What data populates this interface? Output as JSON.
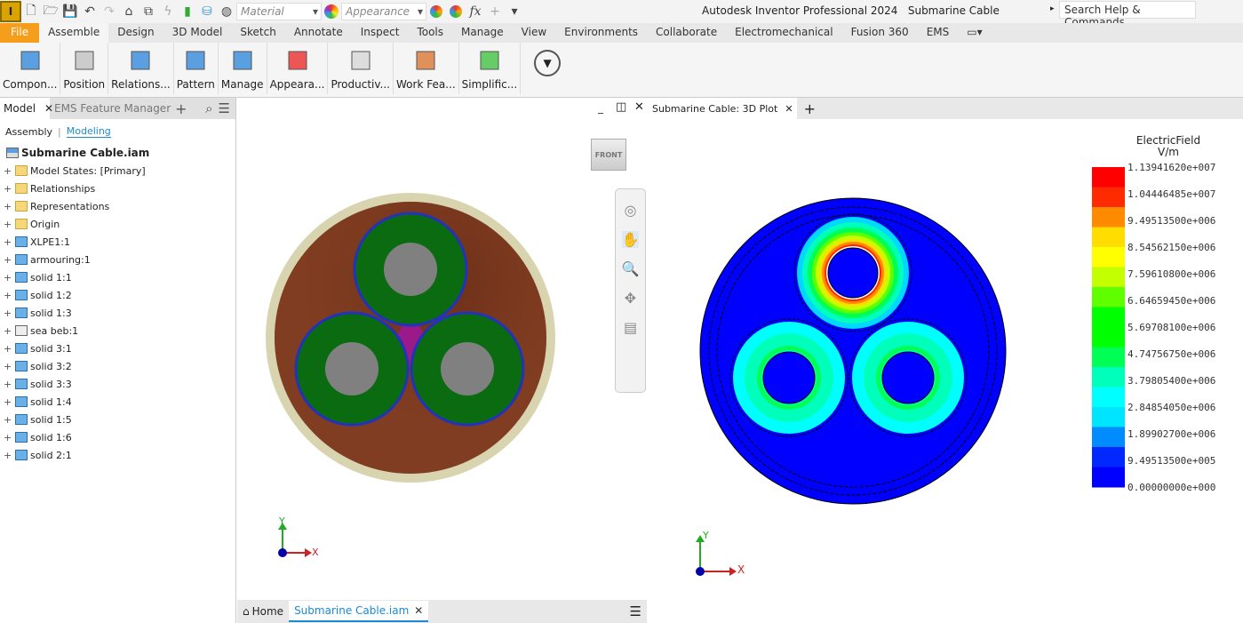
{
  "app": {
    "title": "Autodesk Inventor Professional 2024",
    "document": "Submarine Cable",
    "search_placeholder": "Search Help & Commands...",
    "logo": "I"
  },
  "qat": {
    "material": "Material",
    "appearance": "Appearance"
  },
  "menu_tabs": [
    "File",
    "Assemble",
    "Design",
    "3D Model",
    "Sketch",
    "Annotate",
    "Inspect",
    "Tools",
    "Manage",
    "View",
    "Environments",
    "Collaborate",
    "Electromechanical",
    "Fusion 360",
    "EMS"
  ],
  "active_tab": "Assemble",
  "ribbon": [
    {
      "label": "Compon...",
      "icon": "component-icon"
    },
    {
      "label": "Position",
      "icon": "position-icon"
    },
    {
      "label": "Relations...",
      "icon": "relationships-icon"
    },
    {
      "label": "Pattern",
      "icon": "pattern-icon"
    },
    {
      "label": "Manage",
      "icon": "manage-icon"
    },
    {
      "label": "Appeara...",
      "icon": "appearance-icon"
    },
    {
      "label": "Productiv...",
      "icon": "productivity-icon"
    },
    {
      "label": "Work Fea...",
      "icon": "work-features-icon"
    },
    {
      "label": "Simplific...",
      "icon": "simplification-icon"
    }
  ],
  "browser": {
    "tab_model": "Model",
    "tab_ems": "EMS Feature Manager",
    "mode_assembly": "Assembly",
    "mode_modeling": "Modeling",
    "root": "Submarine Cable.iam",
    "items": [
      {
        "label": "Model States: [Primary]",
        "icon": "folder"
      },
      {
        "label": "Relationships",
        "icon": "folder"
      },
      {
        "label": "Representations",
        "icon": "folder"
      },
      {
        "label": "Origin",
        "icon": "folder"
      },
      {
        "label": "XLPE1:1",
        "icon": "part"
      },
      {
        "label": "armouring:1",
        "icon": "part"
      },
      {
        "label": "solid 1:1",
        "icon": "part"
      },
      {
        "label": "solid 1:2",
        "icon": "part"
      },
      {
        "label": "solid 1:3",
        "icon": "part"
      },
      {
        "label": "sea beb:1",
        "icon": "part-frame"
      },
      {
        "label": "solid 3:1",
        "icon": "part"
      },
      {
        "label": "solid 3:2",
        "icon": "part"
      },
      {
        "label": "solid 3:3",
        "icon": "part"
      },
      {
        "label": "solid 1:4",
        "icon": "part"
      },
      {
        "label": "solid 1:5",
        "icon": "part"
      },
      {
        "label": "solid 1:6",
        "icon": "part"
      },
      {
        "label": "solid 2:1",
        "icon": "part"
      }
    ]
  },
  "viewport": {
    "viewcube": "FRONT",
    "axis_x": "X",
    "axis_y": "Y"
  },
  "bottom_tabs": {
    "home": "Home",
    "doc": "Submarine Cable.iam"
  },
  "plot": {
    "tab": "Submarine Cable: 3D Plot",
    "legend_title": "ElectricField",
    "legend_unit": "V/m",
    "legend_labels": [
      "1.13941620e+007",
      "1.04446485e+007",
      "9.49513500e+006",
      "8.54562150e+006",
      "7.59610800e+006",
      "6.64659450e+006",
      "5.69708100e+006",
      "4.74756750e+006",
      "3.79805400e+006",
      "2.84854050e+006",
      "1.89902700e+006",
      "9.49513500e+005",
      "0.00000000e+000"
    ],
    "legend_colors": [
      "#ff0000",
      "#ff2a00",
      "#ff8a00",
      "#ffdd00",
      "#ffff00",
      "#c4ff00",
      "#5fff00",
      "#00ff00",
      "#00ff00",
      "#00ff55",
      "#00ffbb",
      "#00ffff",
      "#00e5ff",
      "#008cff",
      "#0028ff",
      "#0000ff"
    ],
    "axis_x": "X",
    "axis_y": "Y"
  }
}
